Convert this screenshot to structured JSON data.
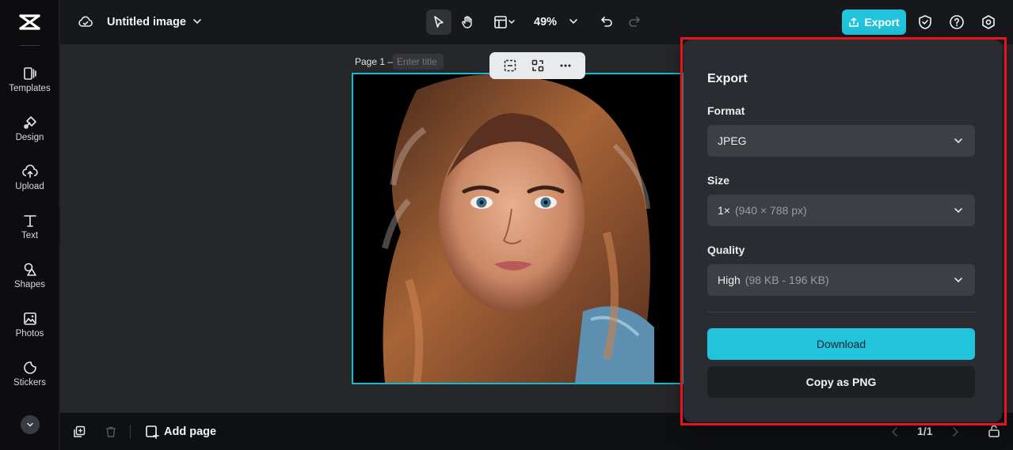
{
  "sidebar": {
    "logo": "capcut-logo",
    "items": [
      {
        "label": "Templates",
        "icon": "templates-icon"
      },
      {
        "label": "Design",
        "icon": "design-icon"
      },
      {
        "label": "Upload",
        "icon": "upload-icon"
      },
      {
        "label": "Text",
        "icon": "text-icon"
      },
      {
        "label": "Shapes",
        "icon": "shapes-icon"
      },
      {
        "label": "Photos",
        "icon": "photos-icon"
      },
      {
        "label": "Stickers",
        "icon": "stickers-icon"
      }
    ]
  },
  "header": {
    "doc_title": "Untitled image",
    "zoom": "49%",
    "export_label": "Export"
  },
  "canvas": {
    "page_label": "Page 1 –",
    "page_title_placeholder": "Enter title"
  },
  "bottom": {
    "add_page_label": "Add page",
    "page_count": "1/1"
  },
  "export_panel": {
    "title": "Export",
    "format": {
      "label": "Format",
      "value": "JPEG"
    },
    "size": {
      "label": "Size",
      "value": "1×",
      "detail": "(940 × 788 px)"
    },
    "quality": {
      "label": "Quality",
      "value": "High",
      "detail": "(98 KB - 196 KB)"
    },
    "download_label": "Download",
    "copy_label": "Copy as PNG"
  },
  "colors": {
    "accent": "#22c3dc",
    "highlight": "#e8141b",
    "panel_bg": "#2b2c31"
  }
}
